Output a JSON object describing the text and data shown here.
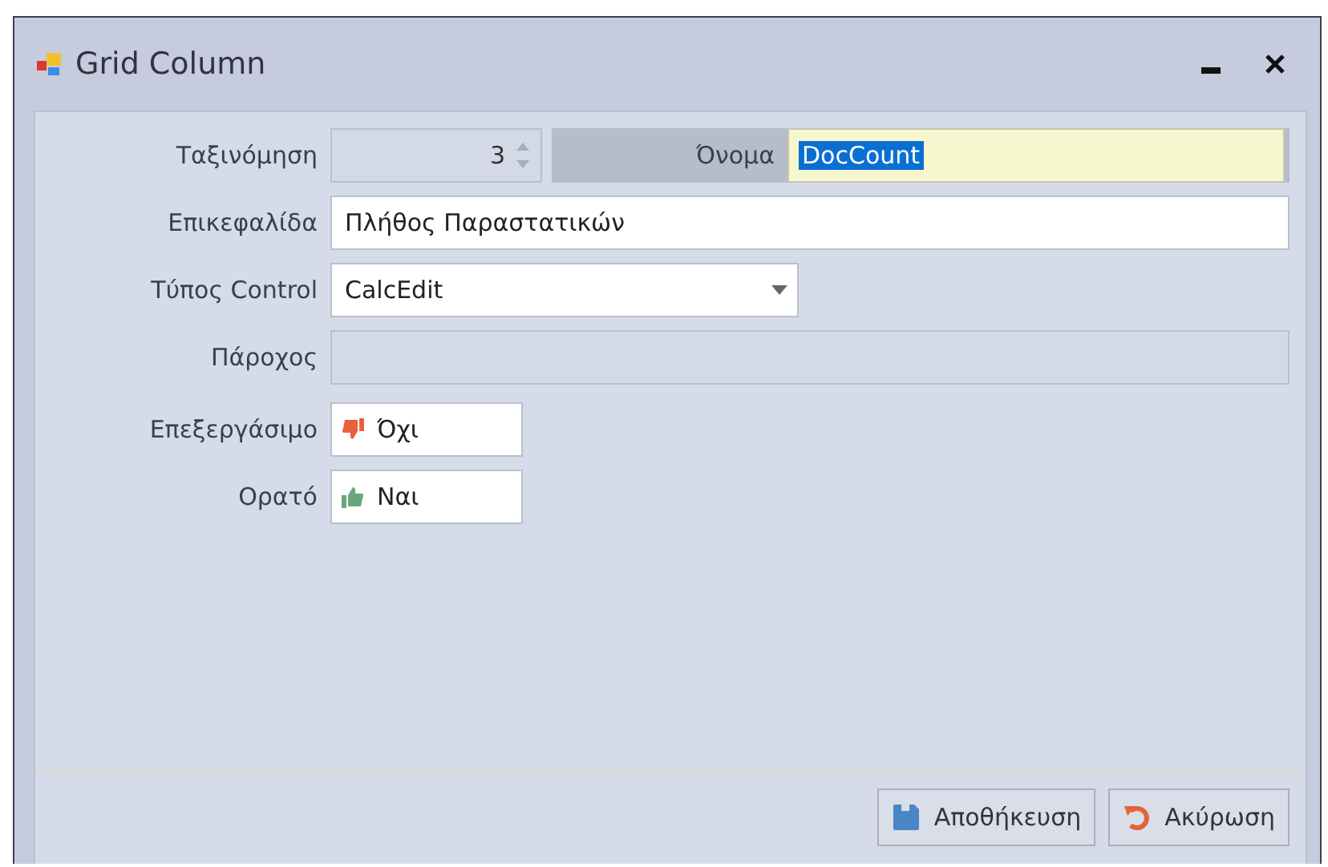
{
  "window": {
    "title": "Grid Column"
  },
  "order": {
    "label": "Ταξινόμηση",
    "value": "3",
    "disabled": true
  },
  "name": {
    "label": "Όνομα",
    "value": "DocCount",
    "focused": true
  },
  "fields": [
    {
      "kind": "text",
      "label": "Επικεφαλίδα",
      "value": "Πλήθος Παραστατικών",
      "disabled": false
    },
    {
      "kind": "combo",
      "label": "Τύπος Control",
      "value": "CalcEdit",
      "disabled": false
    },
    {
      "kind": "text",
      "label": "Πάροχος",
      "disabled": true
    },
    {
      "kind": "toggle",
      "label": "Επεξεργάσιμο",
      "value": "Όχι",
      "on": false
    },
    {
      "kind": "toggle",
      "label": "Ορατό",
      "value": "Ναι",
      "on": true
    }
  ],
  "buttons": [
    {
      "kind": "save",
      "label": "Αποθήκευση"
    },
    {
      "kind": "cancel",
      "label": "Ακύρωση"
    }
  ]
}
